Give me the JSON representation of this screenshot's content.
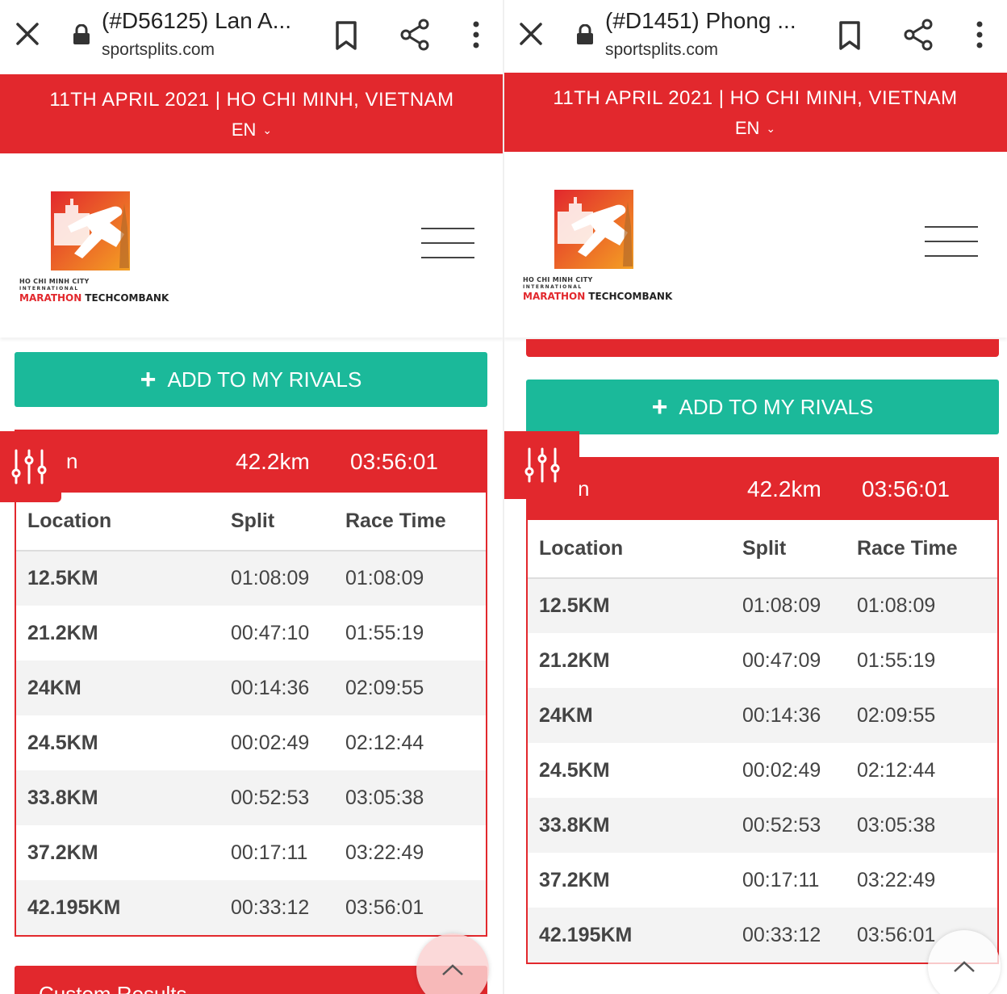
{
  "panes": {
    "left": {
      "browser": {
        "title": "(#D56125) Lan A...",
        "url": "sportsplits.com"
      },
      "banner": {
        "date": "11TH APRIL 2021 | HO CHI MINH, VIETNAM",
        "language": "EN"
      },
      "logo": {
        "line1": "HO CHI MINH CITY",
        "line2": "INTERNATIONAL",
        "marathon": "MARATHON",
        "sponsor": "TECHCOMBANK"
      },
      "rivals_button": "ADD TO MY RIVALS",
      "summary": {
        "name_fragment": "n",
        "distance": "42.2km",
        "finish_time": "03:56:01"
      },
      "table": {
        "headers": [
          "Location",
          "Split",
          "Race Time"
        ],
        "rows": [
          [
            "12.5KM",
            "01:08:09",
            "01:08:09"
          ],
          [
            "21.2KM",
            "00:47:10",
            "01:55:19"
          ],
          [
            "24KM",
            "00:14:36",
            "02:09:55"
          ],
          [
            "24.5KM",
            "00:02:49",
            "02:12:44"
          ],
          [
            "33.8KM",
            "00:52:53",
            "03:05:38"
          ],
          [
            "37.2KM",
            "00:17:11",
            "03:22:49"
          ],
          [
            "42.195KM",
            "00:33:12",
            "03:56:01"
          ]
        ]
      },
      "bottom_section": "Custom Results"
    },
    "right": {
      "browser": {
        "title": "(#D1451) Phong ...",
        "url": "sportsplits.com"
      },
      "banner": {
        "date": "11TH APRIL 2021 | HO CHI MINH, VIETNAM",
        "language": "EN"
      },
      "logo": {
        "line1": "HO CHI MINH CITY",
        "line2": "INTERNATIONAL",
        "marathon": "MARATHON",
        "sponsor": "TECHCOMBANK"
      },
      "rivals_button": "ADD TO MY RIVALS",
      "summary": {
        "name_fragment": "n",
        "distance": "42.2km",
        "finish_time": "03:56:01"
      },
      "table": {
        "headers": [
          "Location",
          "Split",
          "Race Time"
        ],
        "rows": [
          [
            "12.5KM",
            "01:08:09",
            "01:08:09"
          ],
          [
            "21.2KM",
            "00:47:09",
            "01:55:19"
          ],
          [
            "24KM",
            "00:14:36",
            "02:09:55"
          ],
          [
            "24.5KM",
            "00:02:49",
            "02:12:44"
          ],
          [
            "33.8KM",
            "00:52:53",
            "03:05:38"
          ],
          [
            "37.2KM",
            "00:17:11",
            "03:22:49"
          ],
          [
            "42.195KM",
            "00:33:12",
            "03:56:01"
          ]
        ]
      }
    }
  },
  "colors": {
    "brand_red": "#e2282d",
    "rivals_green": "#1bb99a",
    "row_alt": "#f3f3f3"
  },
  "icons": [
    "close-icon",
    "lock-icon",
    "bookmark-icon",
    "share-icon",
    "more-vert-icon",
    "chevron-down-icon",
    "menu-icon",
    "plus-icon",
    "filter-sliders-icon",
    "chevron-up-icon"
  ]
}
